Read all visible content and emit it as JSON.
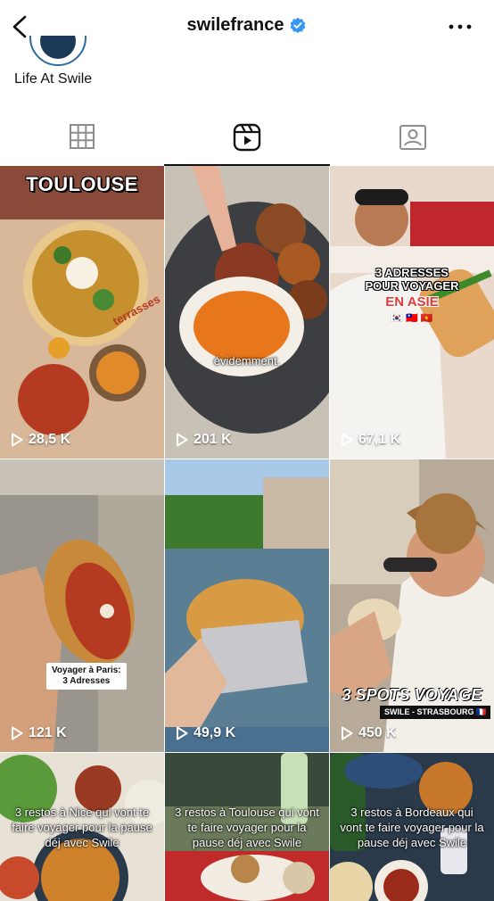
{
  "header": {
    "username": "swilefrance",
    "verified": true,
    "back_icon": "chevron-left-icon",
    "more_icon": "more-horizontal-icon"
  },
  "profile": {
    "highlight_name": "Life At Swile"
  },
  "tabs": [
    {
      "name": "grid",
      "icon": "grid-icon",
      "active": false
    },
    {
      "name": "reels",
      "icon": "reels-icon",
      "active": true
    },
    {
      "name": "tagged",
      "icon": "tagged-icon",
      "active": false
    }
  ],
  "colors": {
    "verified_blue": "#3897f0",
    "text": "#111111",
    "background": "#ffffff"
  },
  "reels": [
    {
      "views": "28,5 K",
      "overlay": "TOULOUSE",
      "overlay2": "terrasses"
    },
    {
      "views": "201 K",
      "overlay": "évidemment."
    },
    {
      "views": "67,1 K",
      "overlay": "3 ADRESSES\nPOUR VOYAGER",
      "overlay2": "EN ASIE",
      "overlay3": "🇰🇷 🇹🇼 🇻🇳"
    },
    {
      "views": "121 K",
      "overlay": "Voyager à Paris:",
      "overlay2": "3 Adresses"
    },
    {
      "views": "49,9 K"
    },
    {
      "views": "450 K",
      "overlay": "3 SPOTS VOYAGE",
      "overlay2": "SWILE - STRASBOURG 🇫🇷"
    },
    {
      "views": "",
      "overlay": "3 restos à Nice qui vont te faire voyager pour la pause déj avec Swile"
    },
    {
      "views": "",
      "overlay": "3 restos à Toulouse qui vont te faire voyager pour la pause déj avec Swile"
    },
    {
      "views": "",
      "overlay": "3 restos à Bordeaux qui vont te faire voyager pour la pause déj avec Swile"
    }
  ]
}
